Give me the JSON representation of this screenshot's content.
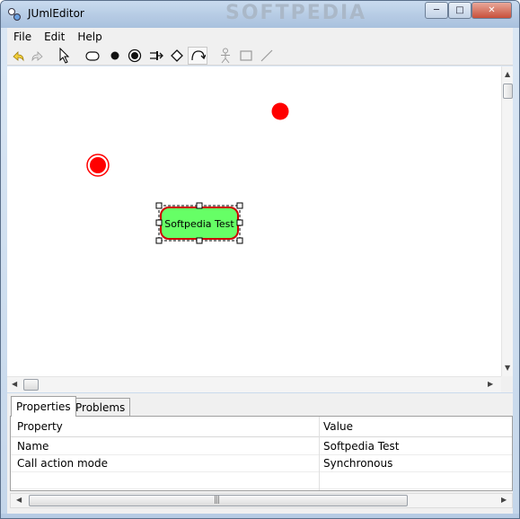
{
  "window": {
    "title": "JUmlEditor",
    "watermark": "SOFTPEDIA",
    "controls": {
      "minimize": "─",
      "maximize": "□",
      "close": "✕"
    }
  },
  "menu": {
    "items": [
      "File",
      "Edit",
      "Help"
    ]
  },
  "toolbar": {
    "tools": [
      "undo-icon",
      "redo-icon",
      "select-pointer-icon",
      "action-state-icon",
      "initial-state-icon",
      "final-state-icon",
      "fork-join-icon",
      "decision-icon",
      "transition-icon",
      "actor-icon",
      "rectangle-icon",
      "line-icon"
    ]
  },
  "canvas": {
    "initial_node_color": "#ff0000",
    "final_node_color": "#ff0000",
    "action_node": {
      "label": "Softpedia Test",
      "fill": "#66ff66",
      "border": "#cc0000"
    }
  },
  "properties_panel": {
    "tabs": [
      "Properties",
      "Problems"
    ],
    "active_tab": "Properties",
    "columns": [
      "Property",
      "Value"
    ],
    "rows": [
      {
        "property": "Name",
        "value": "Softpedia Test"
      },
      {
        "property": "Call action mode",
        "value": "Synchronous"
      }
    ]
  }
}
